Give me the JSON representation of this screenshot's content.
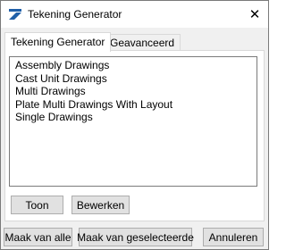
{
  "window": {
    "title": "Tekening Generator",
    "close_glyph": "✕"
  },
  "tabs": [
    {
      "label": "Tekening Generator",
      "active": true
    },
    {
      "label": "Geavanceerd",
      "active": false
    }
  ],
  "list": {
    "items": [
      "Assembly Drawings",
      "Cast Unit Drawings",
      "Multi Drawings",
      "Plate Multi Drawings With Layout",
      "Single Drawings"
    ]
  },
  "panel_buttons": {
    "show_label": "Toon",
    "edit_label": "Bewerken"
  },
  "footer_buttons": {
    "make_all_label": "Maak van alle",
    "make_selected_label": "Maak van geselecteerde",
    "cancel_label": "Annuleren"
  },
  "colors": {
    "icon_blue": "#1f5fa8",
    "border": "#adadad",
    "button_face": "#e1e1e1"
  },
  "icons": {
    "app": "app-logo-icon",
    "close": "close-icon"
  }
}
